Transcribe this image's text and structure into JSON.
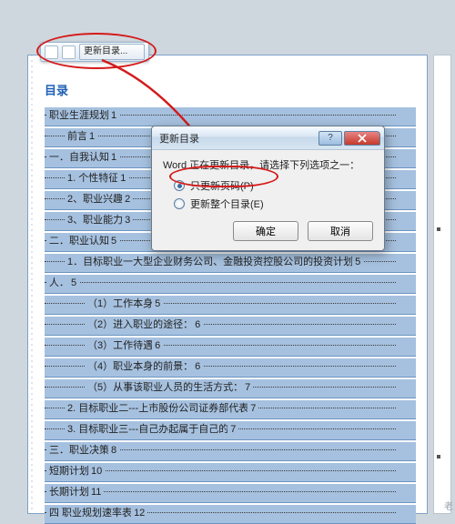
{
  "context_menu": {
    "update_toc_label": "更新目录..."
  },
  "toc": {
    "title": "目录",
    "lines": [
      {
        "text": "职业生涯规划",
        "page": "1",
        "indent": 0
      },
      {
        "text": "前言",
        "page": "1",
        "indent": 1
      },
      {
        "text": "一．自我认知",
        "page": "1",
        "indent": 0
      },
      {
        "text": "1. 个性特征",
        "page": "1",
        "indent": 1
      },
      {
        "text": "2、职业兴趣",
        "page": "2",
        "indent": 1
      },
      {
        "text": "3、职业能力",
        "page": "3",
        "indent": 1
      },
      {
        "text": "二．职业认知",
        "page": "5",
        "indent": 0
      },
      {
        "text": "1．目标职业一大型企业财务公司、金融投资控股公司的投资计划",
        "page": "5",
        "indent": 1
      },
      {
        "text": "人．",
        "page": "5",
        "indent": 0
      },
      {
        "text": "（1）工作本身",
        "page": "5",
        "indent": 2
      },
      {
        "text": "（2）进入职业的途径：",
        "page": "6",
        "indent": 2
      },
      {
        "text": "（3）工作待遇",
        "page": "6",
        "indent": 2
      },
      {
        "text": "（4）职业本身的前景：",
        "page": "6",
        "indent": 2
      },
      {
        "text": "（5）从事该职业人员的生活方式：",
        "page": "7",
        "indent": 2
      },
      {
        "text": "2. 目标职业二---上市股份公司证券部代表",
        "page": "7",
        "indent": 1
      },
      {
        "text": "3. 目标职业三---自己办起属于自己的",
        "page": "7",
        "indent": 1
      },
      {
        "text": "三．职业决策",
        "page": "8",
        "indent": 0
      },
      {
        "text": "短期计划",
        "page": "10",
        "indent": 0
      },
      {
        "text": "长期计划",
        "page": "11",
        "indent": 0
      },
      {
        "text": "四  职业规划速率表",
        "page": "12",
        "indent": 0
      }
    ]
  },
  "dialog": {
    "title": "更新目录",
    "prompt": "Word 正在更新目录，请选择下列选项之一：",
    "option_pages": "只更新页码(P)",
    "option_entire": "更新整个目录(E)",
    "ok": "确定",
    "cancel": "取消"
  },
  "watermark": "老"
}
